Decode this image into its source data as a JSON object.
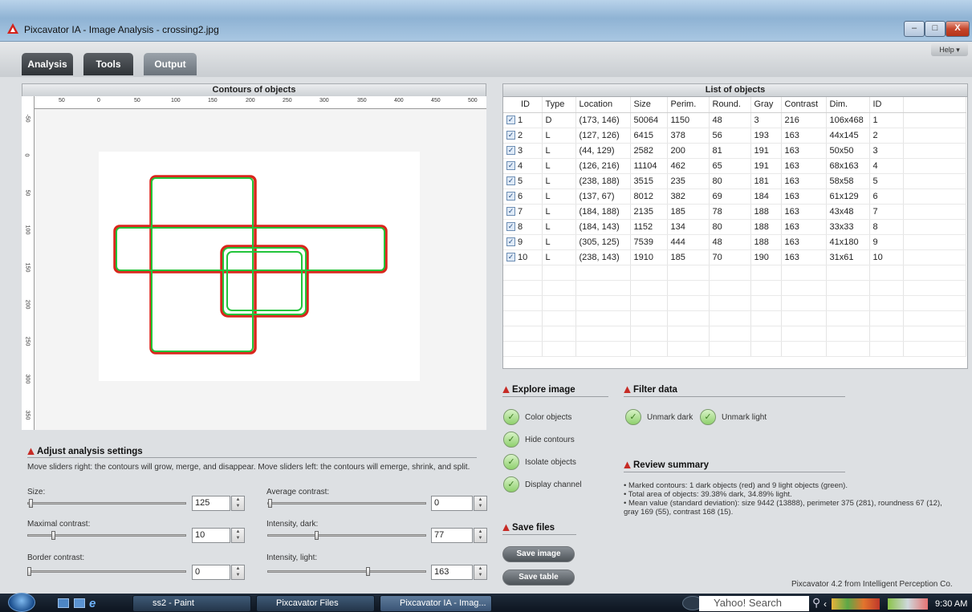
{
  "window": {
    "title": "Pixcavator IA - Image Analysis - crossing2.jpg",
    "min": "–",
    "max": "□",
    "close": "X"
  },
  "tabs": [
    {
      "label": "Analysis"
    },
    {
      "label": "Tools"
    },
    {
      "label": "Output"
    }
  ],
  "help_label": "Help ▾",
  "contours_panel": {
    "title": "Contours of objects",
    "top_ruler": [
      "50",
      "0",
      "50",
      "100",
      "150",
      "200",
      "250",
      "300",
      "350",
      "400",
      "450",
      "500"
    ],
    "left_ruler": [
      "-50",
      "0",
      "50",
      "100",
      "150",
      "200",
      "250",
      "300",
      "350"
    ]
  },
  "adjust": {
    "title": "Adjust analysis settings",
    "hint": "Move sliders right: the contours will grow, merge, and disappear. Move sliders left: the contours will emerge, shrink, and split.",
    "sliders": [
      {
        "label": "Size:",
        "value": "125"
      },
      {
        "label": "Average contrast:",
        "value": "0"
      },
      {
        "label": "Maximal contrast:",
        "value": "10"
      },
      {
        "label": "Intensity, dark:",
        "value": "77"
      },
      {
        "label": "Border contrast:",
        "value": "0"
      },
      {
        "label": "Intensity, light:",
        "value": "163"
      }
    ]
  },
  "list": {
    "title": "List of objects",
    "columns": [
      "ID",
      "Type",
      "Location",
      "Size",
      "Perim.",
      "Round.",
      "Gray",
      "Contrast",
      "Dim.",
      "ID"
    ],
    "rows": [
      [
        "1",
        "D",
        "(173, 146)",
        "50064",
        "1150",
        "48",
        "3",
        "216",
        "106x468",
        "1"
      ],
      [
        "2",
        "L",
        "(127, 126)",
        "6415",
        "378",
        "56",
        "193",
        "163",
        "44x145",
        "2"
      ],
      [
        "3",
        "L",
        "(44, 129)",
        "2582",
        "200",
        "81",
        "191",
        "163",
        "50x50",
        "3"
      ],
      [
        "4",
        "L",
        "(126, 216)",
        "11104",
        "462",
        "65",
        "191",
        "163",
        "68x163",
        "4"
      ],
      [
        "5",
        "L",
        "(238, 188)",
        "3515",
        "235",
        "80",
        "181",
        "163",
        "58x58",
        "5"
      ],
      [
        "6",
        "L",
        "(137, 67)",
        "8012",
        "382",
        "69",
        "184",
        "163",
        "61x129",
        "6"
      ],
      [
        "7",
        "L",
        "(184, 188)",
        "2135",
        "185",
        "78",
        "188",
        "163",
        "43x48",
        "7"
      ],
      [
        "8",
        "L",
        "(184, 143)",
        "1152",
        "134",
        "80",
        "188",
        "163",
        "33x33",
        "8"
      ],
      [
        "9",
        "L",
        "(305, 125)",
        "7539",
        "444",
        "48",
        "188",
        "163",
        "41x180",
        "9"
      ],
      [
        "10",
        "L",
        "(238, 143)",
        "1910",
        "185",
        "70",
        "190",
        "163",
        "31x61",
        "10"
      ]
    ]
  },
  "explore": {
    "title": "Explore image",
    "buttons": [
      "Color objects",
      "Hide contours",
      "Isolate objects",
      "Display channel"
    ]
  },
  "filter": {
    "title": "Filter data",
    "buttons": [
      "Unmark dark",
      "Unmark light"
    ]
  },
  "review": {
    "title": "Review summary",
    "lines": [
      "• Marked contours: 1 dark objects (red) and 9 light objects (green).",
      "• Total area of objects: 39.38% dark, 34.89% light.",
      "• Mean value (standard deviation): size 9442 (13888), perimeter 375 (281), roundness 67 (12),",
      "gray 169 (55), contrast 168 (15)."
    ]
  },
  "save": {
    "title": "Save files",
    "image_btn": "Save image",
    "table_btn": "Save table"
  },
  "footer": "Pixcavator 4.2 from Intelligent Perception Co.",
  "taskbar": {
    "items": [
      "ss2 - Paint",
      "Pixcavator Files",
      "Pixcavator IA - Imag..."
    ],
    "search": "Yahoo! Search",
    "clock": "9:30 AM"
  }
}
